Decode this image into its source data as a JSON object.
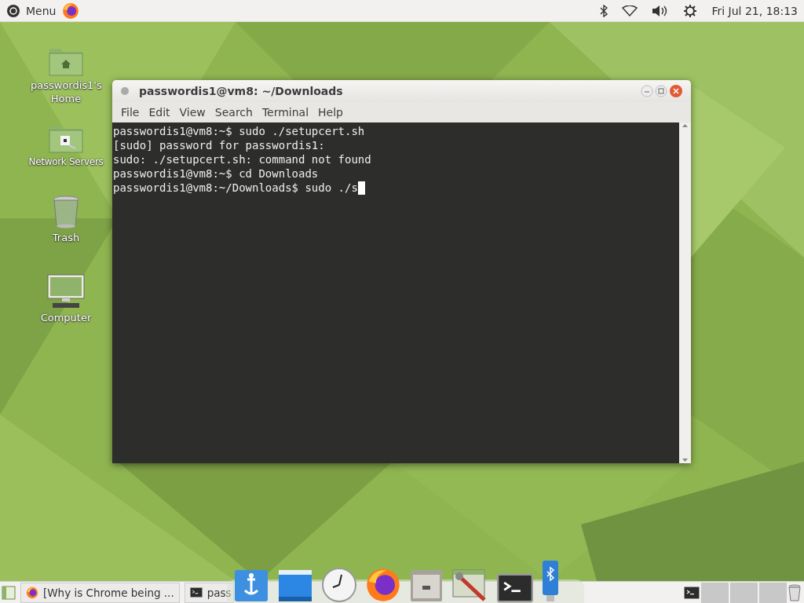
{
  "top_panel": {
    "menu_label": "Menu",
    "clock": "Fri Jul 21, 18:13"
  },
  "desktop_icons": [
    {
      "kind": "home",
      "label": "passwordis1's Home"
    },
    {
      "kind": "network",
      "label": "Network Servers"
    },
    {
      "kind": "trash",
      "label": "Trash"
    },
    {
      "kind": "computer",
      "label": "Computer"
    }
  ],
  "terminal": {
    "title": "passwordis1@vm8: ~/Downloads",
    "menu": [
      "File",
      "Edit",
      "View",
      "Search",
      "Terminal",
      "Help"
    ],
    "lines": [
      "passwordis1@vm8:~$ sudo ./setupcert.sh",
      "[sudo] password for passwordis1:",
      "sudo: ./setupcert.sh: command not found",
      "passwordis1@vm8:~$ cd Downloads",
      "passwordis1@vm8:~/Downloads$ sudo ./s"
    ]
  },
  "taskbar": {
    "tasks": [
      {
        "kind": "browser",
        "label": "[Why is Chrome being ..."
      },
      {
        "kind": "terminal",
        "label": "pass"
      }
    ]
  }
}
